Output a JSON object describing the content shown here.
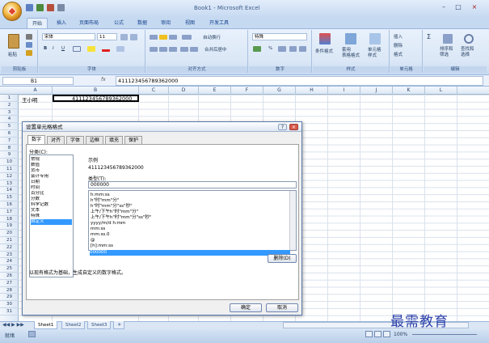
{
  "app": {
    "title": "Book1 - Microsoft Excel"
  },
  "tabs": [
    "开始",
    "插入",
    "页面布局",
    "公式",
    "数据",
    "审阅",
    "视图",
    "开发工具"
  ],
  "ribbon": {
    "clipboard": {
      "label": "剪贴板",
      "paste": "粘贴"
    },
    "font": {
      "label": "字体",
      "name": "宋体",
      "size": "11",
      "bold": "B",
      "italic": "I",
      "underline": "U"
    },
    "alignment": {
      "label": "对齐方式",
      "wrap": "自动换行",
      "merge": "合并后居中"
    },
    "number": {
      "label": "数字",
      "format": "特殊",
      "percent": "%"
    },
    "styles": {
      "label": "样式",
      "conditional": "条件格式",
      "table": "套用\n表格格式",
      "cell": "单元格\n样式"
    },
    "cells": {
      "label": "单元格",
      "insert": "插入",
      "delete": "删除",
      "format": "格式"
    },
    "editing": {
      "label": "编辑",
      "sort": "排序和\n筛选",
      "find": "查找和\n选择"
    }
  },
  "formula_bar": {
    "name_box": "B1",
    "fx": "fx",
    "value": "411123456789362000"
  },
  "columns": [
    "A",
    "B",
    "C",
    "D",
    "E",
    "F",
    "G",
    "H",
    "I",
    "J",
    "K",
    "L"
  ],
  "rows": [
    "1",
    "2",
    "3",
    "4",
    "5",
    "6",
    "7",
    "8",
    "9",
    "10",
    "11",
    "12",
    "13",
    "14",
    "15",
    "16",
    "17",
    "18",
    "19",
    "20",
    "21",
    "22",
    "23",
    "24",
    "25",
    "26",
    "27",
    "28",
    "29",
    "30",
    "31"
  ],
  "cells": {
    "A1": "王小明",
    "B1": "411123456789362000"
  },
  "sheets": [
    "Sheet1",
    "Sheet2",
    "Sheet3"
  ],
  "status": {
    "ready": "就绪",
    "zoom": "100%"
  },
  "dialog": {
    "title": "设置单元格格式",
    "tabs": [
      "数字",
      "对齐",
      "字体",
      "边框",
      "填充",
      "保护"
    ],
    "category_label": "分类(C):",
    "categories": [
      "常规",
      "数值",
      "货币",
      "会计专用",
      "日期",
      "时间",
      "百分比",
      "分数",
      "科学记数",
      "文本",
      "特殊",
      "自定义"
    ],
    "selected_category": "自定义",
    "sample_label": "示例",
    "sample_value": "411123456789362000",
    "type_label": "类型(T):",
    "type_value": "000000",
    "formats": [
      "h:mm:ss",
      "h\"时\"mm\"分\"",
      "h\"时\"mm\"分\"ss\"秒\"",
      "上午/下午h\"时\"mm\"分\"",
      "上午/下午h\"时\"mm\"分\"ss\"秒\"",
      "yyyy/m/d h:mm",
      "mm:ss",
      "mm:ss.0",
      "@",
      "[h]:mm:ss",
      "000000"
    ],
    "selected_format": "000000",
    "delete_btn": "删除(D)",
    "hint": "以现有格式为基础，生成自定义的数字格式。",
    "ok": "确定",
    "cancel": "取消"
  },
  "watermark": "最需教育"
}
